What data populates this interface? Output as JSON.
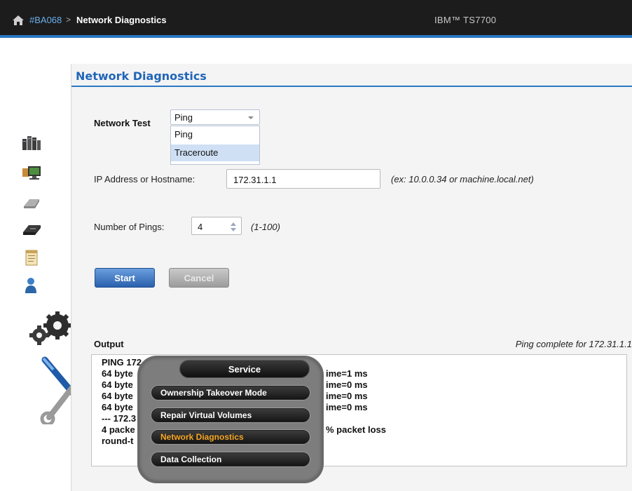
{
  "header": {
    "system_id": "#BA068",
    "separator": ">",
    "page": "Network Diagnostics",
    "product": "IBM™ TS7700"
  },
  "panel": {
    "title": "Network Diagnostics",
    "network_test_label": "Network Test",
    "network_test_value": "Ping",
    "network_test_options": [
      "Ping",
      "Traceroute"
    ],
    "ip_label": "IP Address or Hostname:",
    "ip_value": "172.31.1.1",
    "ip_hint": "(ex: 10.0.0.34 or machine.local.net)",
    "pings_label": "Number of Pings:",
    "pings_value": "4",
    "pings_hint": "(1-100)",
    "start_label": "Start",
    "cancel_label": "Cancel",
    "output_label": "Output",
    "output_status": "Ping complete for 172.31.1.1",
    "output_lines": [
      "PING 172.31.1.1",
      "64 byte",
      "64 byte",
      "64 byte",
      "64 byte",
      "--- 172.3",
      "4 packe",
      "round-t"
    ],
    "output_tails": [
      "ime=1 ms",
      "ime=0 ms",
      "ime=0 ms",
      "ime=0 ms",
      "% packet loss"
    ]
  },
  "service_menu": {
    "title": "Service",
    "items": [
      "Ownership Takeover Mode",
      "Repair Virtual Volumes",
      "Network Diagnostics",
      "Data Collection"
    ],
    "active_item": "Network Diagnostics"
  },
  "nav_icons": [
    "systems-icon",
    "monitor-icon",
    "cartridge-icon",
    "drive-icon",
    "notepad-icon",
    "user-icon"
  ],
  "colors": {
    "accent": "#2a78c2",
    "title_blue": "#2166b8",
    "active_menu": "#f5a623"
  }
}
